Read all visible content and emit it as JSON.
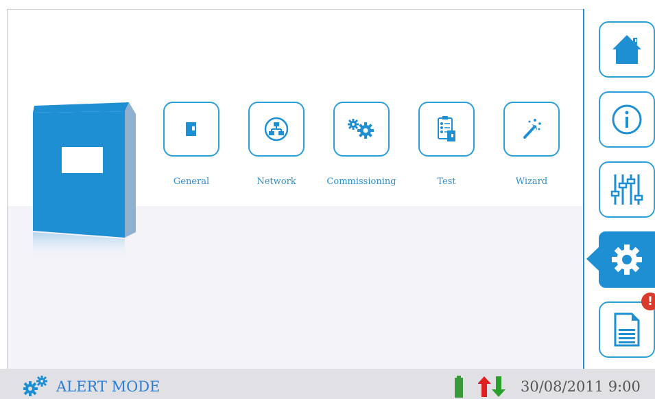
{
  "menu": {
    "items": [
      {
        "label": "General",
        "icon": "document-icon"
      },
      {
        "label": "Network",
        "icon": "network-icon"
      },
      {
        "label": "Commissioning",
        "icon": "gears-icon"
      },
      {
        "label": "Test",
        "icon": "checklist-icon"
      },
      {
        "label": "Wizard",
        "icon": "magic-wand-icon"
      }
    ]
  },
  "sidebar": {
    "items": [
      {
        "icon": "home-icon"
      },
      {
        "icon": "info-icon"
      },
      {
        "icon": "sliders-icon"
      },
      {
        "icon": "gear-icon",
        "active": true
      },
      {
        "icon": "log-document-icon",
        "badge": "!"
      }
    ]
  },
  "status": {
    "mode": "ALERT MODE",
    "datetime": "30/08/2011 9:00"
  },
  "colors": {
    "accent": "#1e8fd3",
    "alert_badge": "#d93a2b",
    "battery": "#3a9a3a",
    "arrow_up": "#e02020",
    "arrow_down": "#2aa02a"
  }
}
